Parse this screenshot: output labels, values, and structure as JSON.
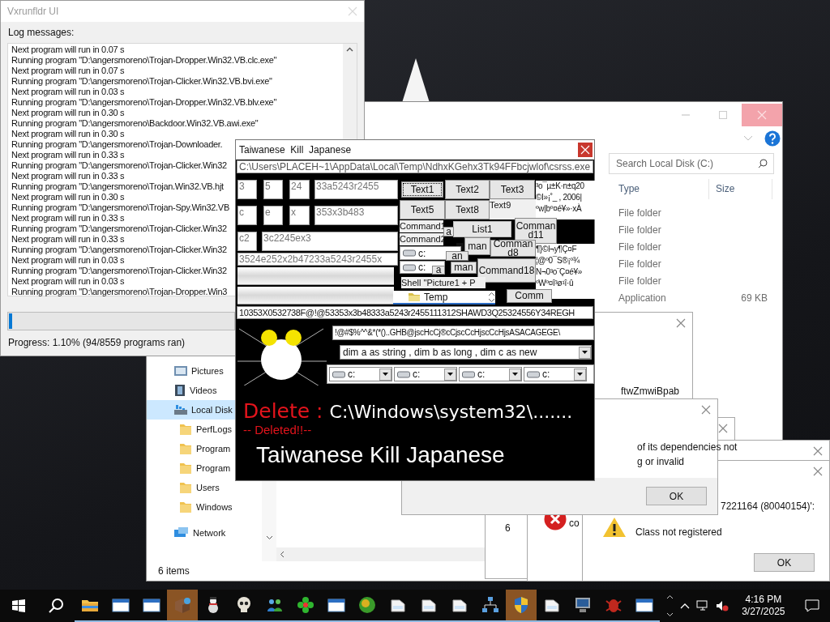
{
  "log_window": {
    "title": "Vxrunfldr UI",
    "label": "Log messages:",
    "lines": [
      "Next program will run in 0.07 s",
      "Running program \"D:\\angersmoreno\\Trojan-Dropper.Win32.VB.clc.exe\"",
      "Next program will run in 0.07 s",
      "Running program \"D:\\angersmoreno\\Trojan-Clicker.Win32.VB.bvi.exe\"",
      "Next program will run in 0.03 s",
      "Running program \"D:\\angersmoreno\\Trojan-Dropper.Win32.VB.blv.exe\"",
      "Next program will run in 0.30 s",
      "Running program \"D:\\angersmoreno\\Backdoor.Win32.VB.awi.exe\"",
      "Next program will run in 0.30 s",
      "Running program \"D:\\angersmoreno\\Trojan-Downloader.",
      "Next program will run in 0.33 s",
      "Running program \"D:\\angersmoreno\\Trojan-Clicker.Win32",
      "Next program will run in 0.33 s",
      "Running program \"D:\\angersmoreno\\Trojan.Win32.VB.hjt",
      "Next program will run in 0.30 s",
      "Running program \"D:\\angersmoreno\\Trojan-Spy.Win32.VB",
      "Next program will run in 0.33 s",
      "Running program \"D:\\angersmoreno\\Trojan-Clicker.Win32",
      "Next program will run in 0.33 s",
      "Running program \"D:\\angersmoreno\\Trojan-Clicker.Win32",
      "Next program will run in 0.03 s",
      "Running program \"D:\\angersmoreno\\Trojan-Clicker.Win32",
      "Next program will run in 0.03 s",
      "Running program \"D:\\angersmoreno\\Trojan-Dropper.Win3"
    ],
    "progress": {
      "level": 0.011
    },
    "status": "Progress: 1.10% (94/8559 programs ran)"
  },
  "explorer": {
    "sidebar": [
      {
        "label": "Pictures",
        "kind": "pictures",
        "selected": false
      },
      {
        "label": "Videos",
        "kind": "videos",
        "selected": false
      },
      {
        "label": "Local Disk",
        "kind": "drive",
        "selected": true,
        "children": [
          {
            "label": "PerfLogs",
            "kind": "folder",
            "selected": false
          },
          {
            "label": "Program",
            "kind": "folder",
            "selected": false
          },
          {
            "label": "Program",
            "kind": "folder",
            "selected": false
          },
          {
            "label": "Users",
            "kind": "folder",
            "selected": false
          },
          {
            "label": "Windows",
            "kind": "folder",
            "selected": false
          }
        ]
      },
      {
        "label": "Network",
        "kind": "network",
        "selected": false
      }
    ],
    "search": {
      "placeholder": "Search Local Disk (C:)"
    },
    "columns": [
      "Type",
      "Size"
    ],
    "rows": [
      {
        "type": "File folder"
      },
      {
        "type": "File folder"
      },
      {
        "type": "File folder"
      },
      {
        "type": "File folder"
      },
      {
        "type": "File folder"
      },
      {
        "type": "Application",
        "size": "69 KB"
      }
    ],
    "status": "6 items"
  },
  "dialogs": [
    {
      "kind": "plain",
      "lines": [
        "ftwZmwiBpab"
      ]
    },
    {
      "kind": "plain",
      "lines": [
        "of its dependencies not",
        "g or invalid"
      ],
      "button": "OK"
    },
    {
      "kind": "plain",
      "lines": [
        "6"
      ]
    },
    {
      "kind": "plain"
    },
    {
      "kind": "warning",
      "lines": [
        "7221164 (80040154)':",
        "Class not registered"
      ],
      "button": "OK"
    },
    {
      "kind": "error",
      "lines": [
        "co"
      ]
    }
  ],
  "malware_window": {
    "title": "Taiwanese  Kill  Japanese",
    "path": "C:\\Users\\PLACEH~1\\AppData\\Local\\Temp\\NdhxKGehx3Tk94FFbcjwlof\\csrss.exe",
    "controls": [
      {
        "kind": "textbox",
        "text": "3"
      },
      {
        "kind": "textbox",
        "text": "5"
      },
      {
        "kind": "textbox",
        "text": "24"
      },
      {
        "kind": "textbox",
        "text": "33a5243r2455"
      },
      {
        "kind": "textbox",
        "text": "c"
      },
      {
        "kind": "textbox",
        "text": "e"
      },
      {
        "kind": "textbox",
        "text": "x"
      },
      {
        "kind": "textbox",
        "text": "353x3b483"
      },
      {
        "kind": "textbox",
        "text": "c2"
      },
      {
        "kind": "textbox",
        "text": "3c2245ex3"
      },
      {
        "kind": "textbox",
        "text": "3524e252x2b47233a5243r2455x"
      },
      {
        "kind": "picture"
      },
      {
        "kind": "picture"
      },
      {
        "kind": "button",
        "text": "Text1",
        "focused": true
      },
      {
        "kind": "button",
        "text": "Text2",
        "focused": false
      },
      {
        "kind": "button",
        "text": "Text3",
        "focused": false
      },
      {
        "kind": "button",
        "text": "Text5",
        "focused": false
      },
      {
        "kind": "button",
        "text": "Text8",
        "focused": false
      },
      {
        "kind": "label",
        "text": "Text9"
      },
      {
        "kind": "garbled",
        "lines": [
          "³o¯µ±K·n±q20",
          "©I»¡˚_ , 2006|",
          "ºw|bº¤é¥»·xÀ"
        ]
      },
      {
        "kind": "garbled",
        "lines": [
          "¶}©l¬y¶Ç¤F",
          "¦@º0¯S®¡º¾",
          "N¬0³o¨Ç¤é¥»",
          "ºWº¤î³ø¹î·û"
        ]
      },
      {
        "kind": "listbox",
        "text": "List1"
      },
      {
        "kind": "button",
        "text": "Command11",
        "focused": false
      },
      {
        "kind": "button",
        "text": "man",
        "focused": false
      },
      {
        "kind": "label",
        "text": "Command1"
      },
      {
        "kind": "label",
        "text": "Command2"
      },
      {
        "kind": "button",
        "text": "a",
        "focused": false
      },
      {
        "kind": "square"
      },
      {
        "kind": "drive",
        "text": "c:"
      },
      {
        "kind": "button",
        "text": "Command8",
        "focused": false
      },
      {
        "kind": "button",
        "text": "an",
        "focused": false
      },
      {
        "kind": "drive",
        "text": "c:"
      },
      {
        "kind": "button",
        "text": "a",
        "focused": false
      },
      {
        "kind": "button",
        "text": "man",
        "focused": false
      },
      {
        "kind": "button",
        "text": "Command18",
        "focused": false
      },
      {
        "kind": "label",
        "text": "Shell  \"Picture1 + P"
      },
      {
        "kind": "dirlist",
        "text": "Temp"
      },
      {
        "kind": "button",
        "text": "Comm",
        "focused": false
      }
    ],
    "code_line": "10353X0532738F@!@53353x3b48333a5243r2455111312SHAWD3Q25324556Y34REGH",
    "symbol_line": "!@#$%^^&*(*()..GHB@jscHcCj®cCjscCcHjscCcHjsASACAGEGE\\",
    "combo": "dim a as string , dim b as long , dim c as new",
    "drives": [
      "c:",
      "c:",
      "c:",
      "c:"
    ],
    "delete_label": "Delete :",
    "delete_path": "C:\\Windows\\system32\\.......",
    "deleted": "-- Deleted!!--",
    "slogan": "Taiwanese Kill Japanese"
  },
  "taskbar": {
    "apps": [
      {
        "kind": "folder",
        "active": false,
        "running": true
      },
      {
        "kind": "window",
        "active": false,
        "running": true
      },
      {
        "kind": "window",
        "active": false,
        "running": true
      },
      {
        "kind": "package",
        "active": true,
        "running": true
      },
      {
        "kind": "snowman",
        "active": false,
        "running": true
      },
      {
        "kind": "skull",
        "active": false,
        "running": true
      },
      {
        "kind": "people",
        "active": false,
        "running": true
      },
      {
        "kind": "flower",
        "active": false,
        "running": true
      },
      {
        "kind": "window",
        "active": false,
        "running": true
      },
      {
        "kind": "globe",
        "active": false,
        "running": true
      },
      {
        "kind": "file",
        "active": false,
        "running": true
      },
      {
        "kind": "file",
        "active": false,
        "running": true
      },
      {
        "kind": "file",
        "active": false,
        "running": true
      },
      {
        "kind": "network",
        "active": false,
        "running": true
      },
      {
        "kind": "shield",
        "active": true,
        "running": true
      },
      {
        "kind": "file",
        "active": false,
        "running": true
      },
      {
        "kind": "monitor",
        "active": false,
        "running": true
      },
      {
        "kind": "bug",
        "active": false,
        "running": true
      },
      {
        "kind": "window",
        "active": false,
        "running": true
      }
    ],
    "time": "4:16 PM",
    "date": "3/27/2025"
  }
}
